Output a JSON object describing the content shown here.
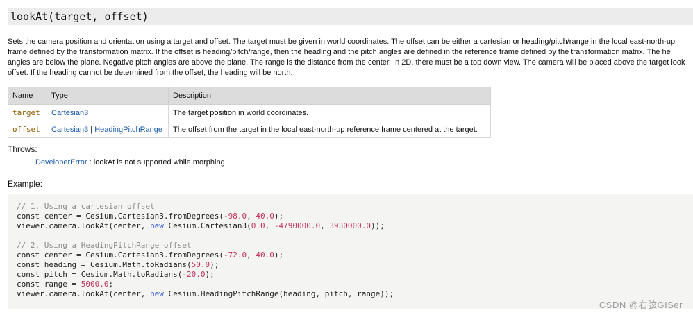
{
  "signature": "lookAt(target, offset)",
  "description": [
    "Sets the camera position and orientation using a target and offset. The target must be given in world coordinates. The offset can be either a cartesian or heading/pitch/range in the local east-north-up",
    "frame defined by the transformation matrix. If the offset is heading/pitch/range, then the heading and the pitch angles are defined in the reference frame defined by the transformation matrix. The he",
    "angles are below the plane. Negative pitch angles are above the plane. The range is the distance from the center. In 2D, there must be a top down view. The camera will be placed above the target look",
    "offset. If the heading cannot be determined from the offset, the heading will be north."
  ],
  "params_table": {
    "headers": [
      "Name",
      "Type",
      "Description"
    ],
    "rows": [
      {
        "name": "target",
        "type1": "Cartesian3",
        "type_sep": "",
        "type2": "",
        "description": "The target position in world coordinates."
      },
      {
        "name": "offset",
        "type1": "Cartesian3",
        "type_sep": " | ",
        "type2": "HeadingPitchRange",
        "description": "The offset from the target in the local east-north-up reference frame centered at the target."
      }
    ]
  },
  "throws": {
    "label": "Throws:",
    "error_type": "DeveloperError",
    "message": " : lookAt is not supported while morphing."
  },
  "example": {
    "label": "Example:",
    "lines": [
      [
        {
          "t": "// 1. Using a cartesian offset",
          "c": "com"
        }
      ],
      [
        {
          "t": "const center = Cesium.Cartesian3.fromDegrees(",
          "c": ""
        },
        {
          "t": "-98.0",
          "c": "num"
        },
        {
          "t": ", ",
          "c": ""
        },
        {
          "t": "40.0",
          "c": "num"
        },
        {
          "t": ");",
          "c": ""
        }
      ],
      [
        {
          "t": "viewer.camera.lookAt(center, ",
          "c": ""
        },
        {
          "t": "new",
          "c": "kw"
        },
        {
          "t": " Cesium.Cartesian3(",
          "c": ""
        },
        {
          "t": "0.0",
          "c": "num"
        },
        {
          "t": ", ",
          "c": ""
        },
        {
          "t": "-4790000.0",
          "c": "num"
        },
        {
          "t": ", ",
          "c": ""
        },
        {
          "t": "3930000.0",
          "c": "num"
        },
        {
          "t": "));",
          "c": ""
        }
      ],
      [],
      [
        {
          "t": "// 2. Using a HeadingPitchRange offset",
          "c": "com"
        }
      ],
      [
        {
          "t": "const center = Cesium.Cartesian3.fromDegrees(",
          "c": ""
        },
        {
          "t": "-72.0",
          "c": "num"
        },
        {
          "t": ", ",
          "c": ""
        },
        {
          "t": "40.0",
          "c": "num"
        },
        {
          "t": ");",
          "c": ""
        }
      ],
      [
        {
          "t": "const heading = Cesium.Math.toRadians(",
          "c": ""
        },
        {
          "t": "50.0",
          "c": "num"
        },
        {
          "t": ");",
          "c": ""
        }
      ],
      [
        {
          "t": "const pitch = Cesium.Math.toRadians(",
          "c": ""
        },
        {
          "t": "-20.0",
          "c": "num"
        },
        {
          "t": ");",
          "c": ""
        }
      ],
      [
        {
          "t": "const range = ",
          "c": ""
        },
        {
          "t": "5000.0",
          "c": "num"
        },
        {
          "t": ";",
          "c": ""
        }
      ],
      [
        {
          "t": "viewer.camera.lookAt(center, ",
          "c": ""
        },
        {
          "t": "new",
          "c": "kw"
        },
        {
          "t": " Cesium.HeadingPitchRange(heading, pitch, range));",
          "c": ""
        }
      ]
    ]
  },
  "watermark": "CSDN @右弦GISer"
}
